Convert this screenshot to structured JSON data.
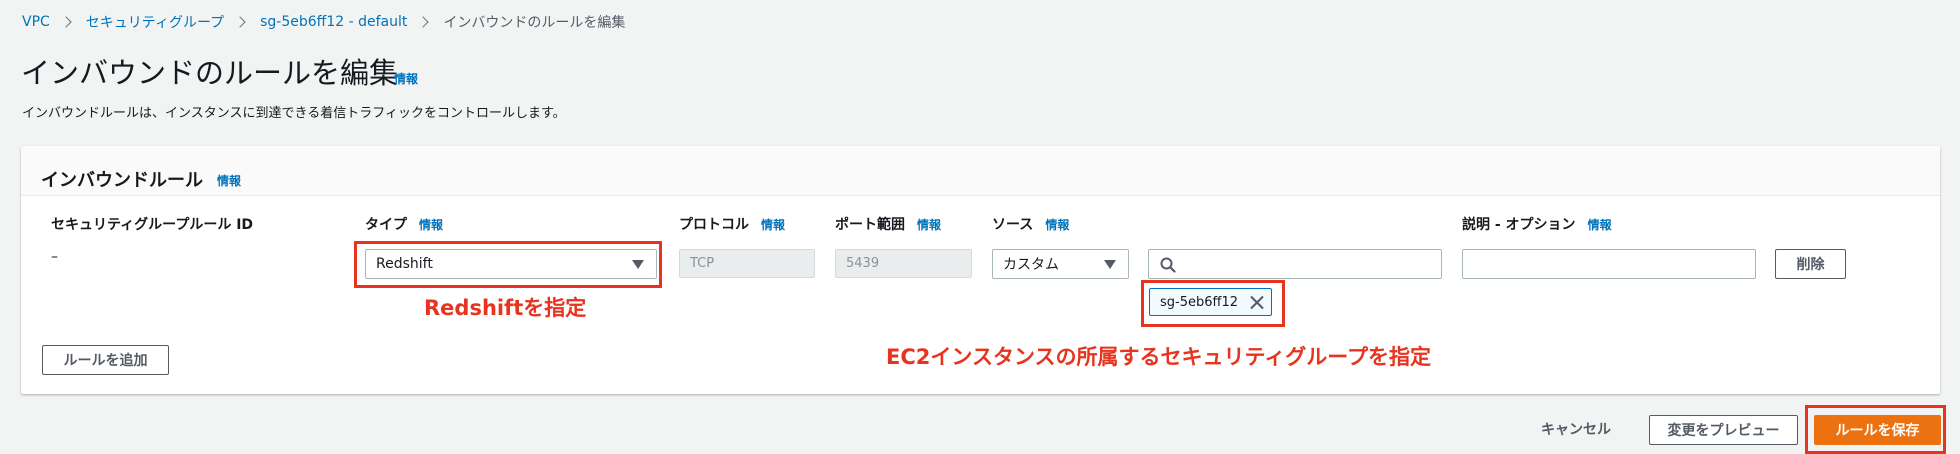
{
  "breadcrumb": {
    "items": [
      "VPC",
      "セキュリティグループ",
      "sg-5eb6ff12 - default"
    ],
    "current": "インバウンドのルールを編集"
  },
  "page": {
    "title": "インバウンドのルールを編集",
    "info": "情報",
    "description": "インバウンドルールは、インスタンスに到達できる着信トラフィックをコントロールします。"
  },
  "panel": {
    "title": "インバウンドルール",
    "info": "情報",
    "columns": {
      "rule_id": "セキュリティグループルール ID",
      "type": "タイプ",
      "protocol": "プロトコル",
      "port_range": "ポート範囲",
      "source": "ソース",
      "description": "説明 - オプション",
      "info": "情報"
    },
    "row": {
      "rule_id": "–",
      "type": "Redshift",
      "protocol": "TCP",
      "port_range": "5439",
      "source_type": "カスタム",
      "source_search": "",
      "source_token": "sg-5eb6ff12",
      "description": "",
      "delete_label": "削除"
    },
    "add_rule_label": "ルールを追加"
  },
  "annotations": {
    "type_note": "Redshiftを指定",
    "source_note": "EC2インスタンスの所属するセキュリティグループを指定"
  },
  "footer": {
    "cancel_label": "キャンセル",
    "preview_label": "変更をプレビュー",
    "save_label": "ルールを保存"
  },
  "colors": {
    "accent": "#0073bb",
    "primary_button": "#ec7211",
    "annotation": "#e8331e"
  }
}
